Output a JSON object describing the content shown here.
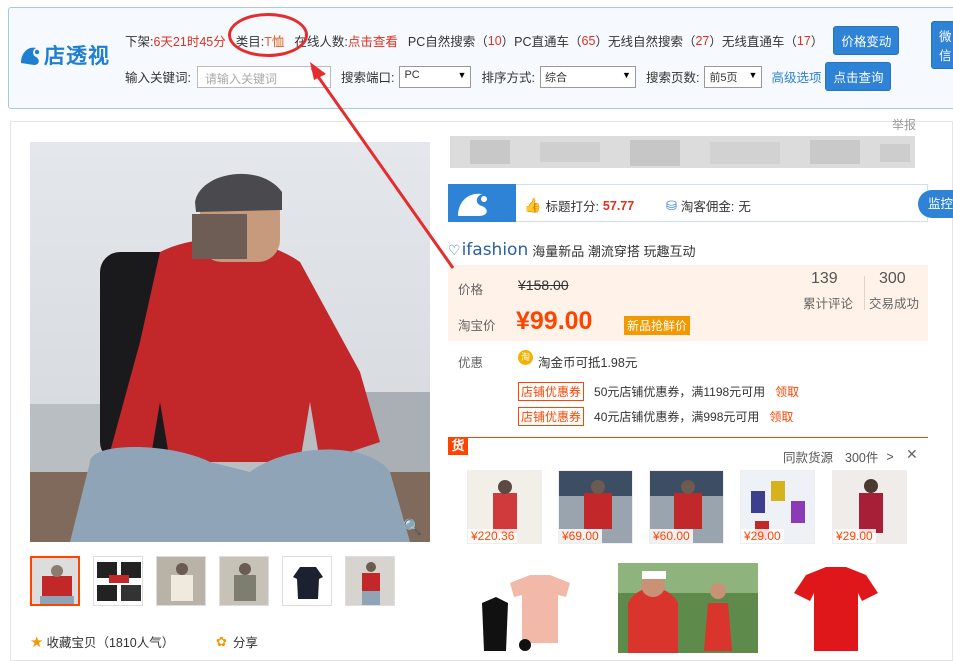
{
  "plugin": {
    "logo": "店透视",
    "row1": {
      "delist_label": "下架:",
      "delist_value": "6天21时45分",
      "category_label": "类目:",
      "category_value": "T恤",
      "online_label": "在线人数:",
      "online_value": "点击查看",
      "pc_search_label": "PC自然搜索（",
      "pc_search_value": "10",
      "pc_ztc_label": "PC直通车（",
      "pc_ztc_value": "65",
      "wx_search_label": "无线自然搜索（",
      "wx_search_value": "27",
      "wx_ztc_label": "无线直通车（",
      "wx_ztc_value": "17",
      "close_paren": "）",
      "price_change_btn": "价格变动",
      "wechat_btn": "微信"
    },
    "row2": {
      "keyword_label": "输入关键词:",
      "keyword_placeholder": "请输入关键词",
      "port_label": "搜索端口:",
      "port_value": "PC",
      "sort_label": "排序方式:",
      "sort_value": "综合",
      "pages_label": "搜索页数:",
      "pages_value": "前5页",
      "advanced_link": "高级选项",
      "query_btn": "点击查询"
    }
  },
  "product": {
    "report": "举报",
    "score_label": "标题打分:",
    "score_value": "57.77",
    "commission_label": "淘客佣金:",
    "commission_value": "无",
    "monitor_btn": "监控",
    "ifashion_logo": "ifashion",
    "ifashion_slogan": "海量新品 潮流穿搭 玩趣互动",
    "price_label": "价格",
    "original_price": "¥158.00",
    "taobao_price_label": "淘宝价",
    "taobao_price": "¥99.00",
    "new_tag": "新品抢鲜价",
    "reviews_count": "139",
    "reviews_label": "累计评论",
    "deals_count": "300",
    "deals_label": "交易成功",
    "promo_label": "优惠",
    "coin_icon_text": "淘",
    "coin_text": "淘金币可抵1.98元",
    "coupons": [
      {
        "tag": "店铺优惠券",
        "text": "50元店铺优惠券，满1198元可用",
        "link": "领取"
      },
      {
        "tag": "店铺优惠券",
        "text": "40元店铺优惠券，满998元可用",
        "link": "领取"
      }
    ],
    "favorite_text": "收藏宝贝（1810人气）",
    "share_text": "分享"
  },
  "similar": {
    "badge": "货",
    "title": "同款货源",
    "count": "300件",
    "chevron": ">",
    "close": "✕",
    "items": [
      {
        "price": "¥220.36"
      },
      {
        "price": "¥69.00"
      },
      {
        "price": "¥60.00"
      },
      {
        "price": "¥29.00"
      },
      {
        "price": "¥29.00"
      }
    ]
  },
  "colors": {
    "accent_blue": "#2f83d6",
    "taobao_orange": "#ff4400",
    "annotation_red": "#e62d2d"
  }
}
